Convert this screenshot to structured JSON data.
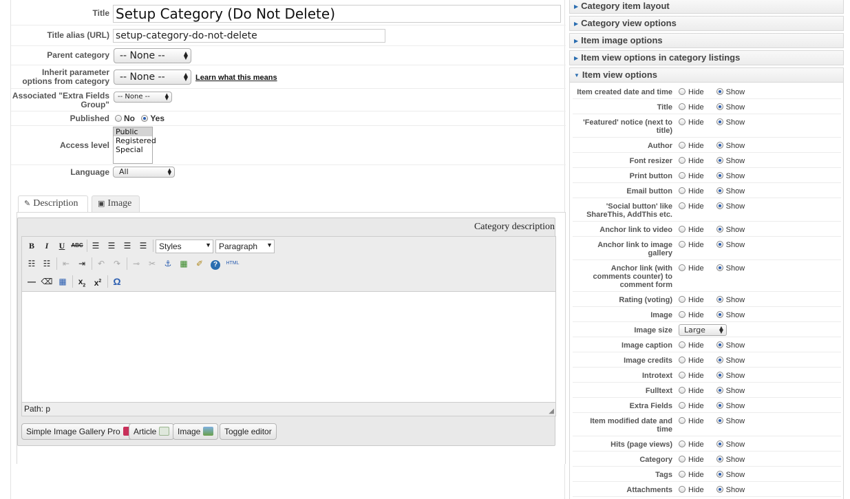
{
  "form": {
    "title_label": "Title",
    "title_value": "Setup Category (Do Not Delete)",
    "alias_label": "Title alias (URL)",
    "alias_value": "setup-category-do-not-delete",
    "parent_label": "Parent category",
    "parent_value": "-- None --",
    "inherit_label": "Inherit parameter options from category",
    "inherit_value": "-- None --",
    "learn_link": "Learn what this means",
    "extra_label": "Associated \"Extra Fields Group\"",
    "extra_value": "-- None --",
    "published_label": "Published",
    "published_no": "No",
    "published_yes": "Yes",
    "access_label": "Access level",
    "access_options": [
      "Public",
      "Registered",
      "Special"
    ],
    "language_label": "Language",
    "language_value": "All"
  },
  "tabs": {
    "description": "Description",
    "image": "Image"
  },
  "editor": {
    "category_description": "Category description",
    "styles": "Styles",
    "paragraph": "Paragraph",
    "path": "Path: p",
    "html_label": "HTML",
    "buttons": {
      "gallery": "Simple Image Gallery Pro",
      "article": "Article",
      "image": "Image",
      "toggle": "Toggle editor"
    }
  },
  "sidebar": {
    "sections": [
      "Category item layout",
      "Category view options",
      "Item image options",
      "Item view options in category listings",
      "Item view options"
    ],
    "hide_label": "Hide",
    "show_label": "Show",
    "image_size_value": "Large",
    "options": [
      {
        "label": "Item created date and time",
        "show": true
      },
      {
        "label": "Title",
        "show": true
      },
      {
        "label": "'Featured' notice (next to title)",
        "show": true
      },
      {
        "label": "Author",
        "show": true
      },
      {
        "label": "Font resizer",
        "show": true
      },
      {
        "label": "Print button",
        "show": true
      },
      {
        "label": "Email button",
        "show": true
      },
      {
        "label": "'Social button' like ShareThis, AddThis etc.",
        "show": true
      },
      {
        "label": "Anchor link to video",
        "show": true
      },
      {
        "label": "Anchor link to image gallery",
        "show": true
      },
      {
        "label": "Anchor link (with comments counter) to comment form",
        "show": true
      },
      {
        "label": "Rating (voting)",
        "show": true
      },
      {
        "label": "Image",
        "show": true
      },
      {
        "label": "Image size",
        "select": true
      },
      {
        "label": "Image caption",
        "show": true
      },
      {
        "label": "Image credits",
        "show": true
      },
      {
        "label": "Introtext",
        "show": true
      },
      {
        "label": "Fulltext",
        "show": true
      },
      {
        "label": "Extra Fields",
        "show": true
      },
      {
        "label": "Item modified date and time",
        "show": true
      },
      {
        "label": "Hits (page views)",
        "show": true
      },
      {
        "label": "Category",
        "show": true
      },
      {
        "label": "Tags",
        "show": true
      },
      {
        "label": "Attachments",
        "show": true
      }
    ]
  },
  "colors": {
    "accent": "#2a5db0",
    "label": "#555555",
    "border": "#d8d8d8"
  }
}
